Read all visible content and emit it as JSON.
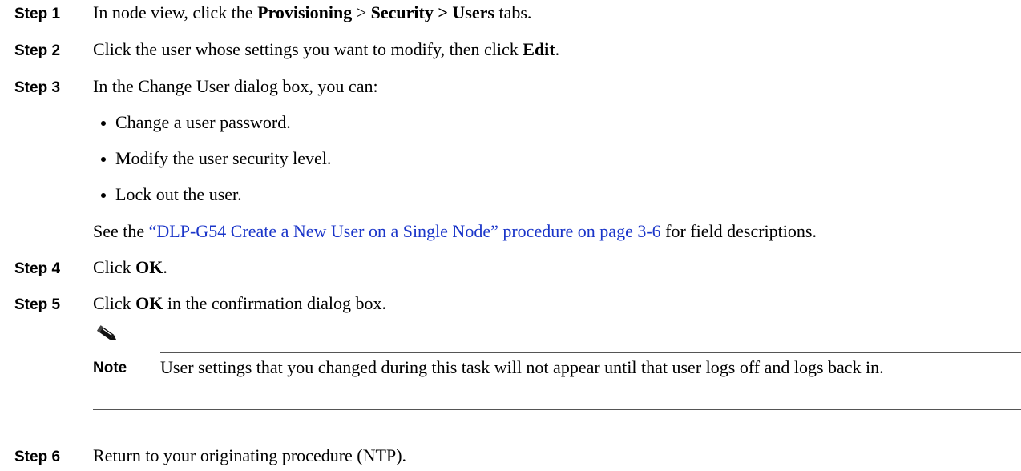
{
  "steps": [
    {
      "label": "Step 1",
      "text_1": "In node view, click the ",
      "bold_1": "Provisioning",
      "text_2": " > ",
      "bold_2": "Security > Users",
      "text_3": " tabs."
    },
    {
      "label": "Step 2",
      "text_1": "Click the user whose settings you want to modify, then click ",
      "bold_1": "Edit",
      "text_2": "."
    },
    {
      "label": "Step 3",
      "text": "In the Change User dialog box, you can:",
      "bullets": [
        "Change a user password.",
        "Modify the user security level.",
        "Lock out the user."
      ],
      "see_prefix": "See the ",
      "see_link": "“DLP-G54 Create a New User on a Single Node” procedure on page 3-6",
      "see_suffix": " for field descriptions."
    },
    {
      "label": "Step 4",
      "text_1": "Click ",
      "bold_1": "OK",
      "text_2": "."
    },
    {
      "label": "Step 5",
      "text_1": "Click ",
      "bold_1": "OK",
      "text_2": " in the confirmation dialog box."
    },
    {
      "label": "Step 6",
      "text": "Return to your originating procedure (NTP)."
    }
  ],
  "note": {
    "icon": "pencil-icon",
    "label": "Note",
    "text": "User settings that you changed during this task will not appear until that user logs off and logs back in."
  },
  "colors": {
    "link": "#1a35c9",
    "rule": "#555555"
  }
}
